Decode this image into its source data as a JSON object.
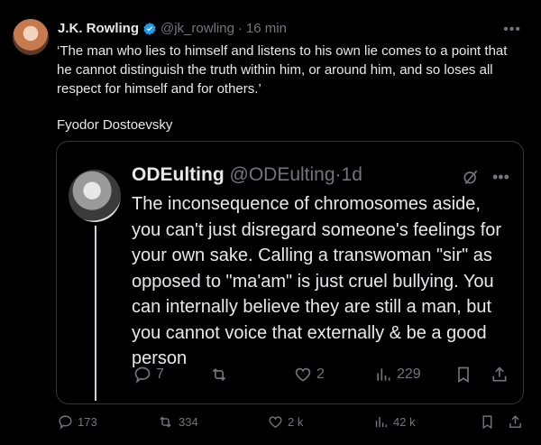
{
  "tweet": {
    "author_name": "J.K. Rowling",
    "handle": "@jk_rowling",
    "separator": "·",
    "time": "16 min",
    "quote_text": "‘The man who lies to himself and listens to his own lie comes to a point that he cannot distinguish the truth within him, or around him, and so loses all respect for himself and for others.’",
    "attribution": "Fyodor Dostoevsky",
    "stats": {
      "replies": "173",
      "reposts": "334",
      "likes": "2 k",
      "views": "42 k"
    }
  },
  "quoted_tweet": {
    "author_name": "ODEulting",
    "handle": "@ODEulting",
    "separator": "·",
    "time": "1d",
    "text": "The inconsequence of chromosomes aside, you can't just disregard someone's feelings for your own sake. Calling a transwoman \"sir\" as opposed to \"ma'am\" is just cruel bullying. You can internally believe they are still a man, but you cannot voice that externally & be a good person",
    "stats": {
      "replies": "7",
      "reposts": "",
      "likes": "2",
      "views": "229"
    }
  },
  "colors": {
    "accent": "#1d9bf0",
    "muted": "#71767b",
    "text": "#e7e9ea",
    "background": "#000000"
  },
  "icons": [
    "verified-badge-icon",
    "more-icon",
    "grok-icon",
    "reply-icon",
    "repost-icon",
    "like-icon",
    "views-icon",
    "bookmark-icon",
    "share-icon"
  ]
}
